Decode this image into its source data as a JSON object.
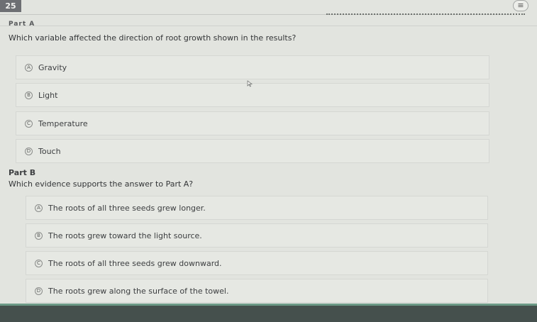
{
  "header": {
    "question_number": "25",
    "menu_icon": "hamburger-icon",
    "crumb_text": "",
    "part_a_label": "Part A"
  },
  "part_a": {
    "question": "Which variable affected the direction of root growth shown in the results?",
    "options": [
      {
        "letter": "A",
        "text": "Gravity"
      },
      {
        "letter": "B",
        "text": "Light"
      },
      {
        "letter": "C",
        "text": "Temperature"
      },
      {
        "letter": "D",
        "text": "Touch"
      }
    ]
  },
  "part_b": {
    "label": "Part B",
    "question": "Which evidence supports the answer to Part A?",
    "options": [
      {
        "letter": "A",
        "text": "The roots of all three seeds grew longer."
      },
      {
        "letter": "B",
        "text": "The roots grew toward the light source."
      },
      {
        "letter": "C",
        "text": "The roots of all three seeds grew downward."
      },
      {
        "letter": "D",
        "text": "The roots grew along the surface of the towel."
      }
    ]
  },
  "cursor_icon": "pointer-cursor-icon",
  "colors": {
    "background": "#e2e4df",
    "option_bg": "#e6e8e3",
    "bottom_bar": "#45504d",
    "bottom_accent": "#6c9a86"
  }
}
